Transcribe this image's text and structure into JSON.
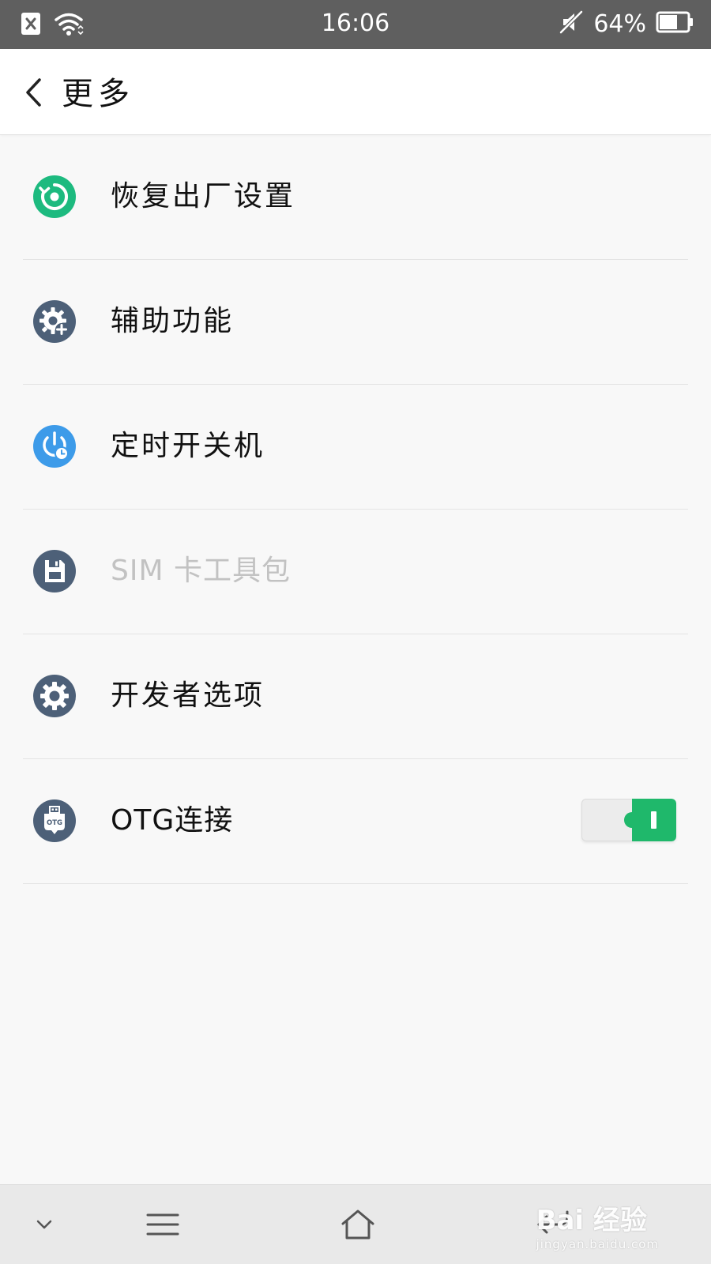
{
  "status_bar": {
    "time": "16:06",
    "battery_percent": "64%",
    "battery_level": 0.64,
    "icons": [
      "close-notification-icon",
      "wifi-icon",
      "mute-icon",
      "battery-icon"
    ]
  },
  "header": {
    "title": "更多",
    "back_icon": "chevron-left-icon"
  },
  "list": {
    "items": [
      {
        "label": "恢复出厂设置",
        "icon": "factory-reset-icon",
        "icon_color": "#1dba7f",
        "enabled": true
      },
      {
        "label": "辅助功能",
        "icon": "accessibility-gear-icon",
        "icon_color": "#4d6078",
        "enabled": true
      },
      {
        "label": "定时开关机",
        "icon": "scheduled-power-icon",
        "icon_color": "#3d9be9",
        "enabled": true
      },
      {
        "label": "SIM 卡工具包",
        "icon": "sim-toolkit-icon",
        "icon_color": "#4d6078",
        "enabled": false
      },
      {
        "label": "开发者选项",
        "icon": "developer-gear-icon",
        "icon_color": "#4d6078",
        "enabled": true
      },
      {
        "label": "OTG连接",
        "icon": "otg-icon",
        "icon_color": "#4d6078",
        "enabled": true,
        "toggle_on": true,
        "toggle_color": "#1fb86b"
      }
    ]
  },
  "nav_bar": {
    "icons": [
      "collapse-chevron-icon",
      "menu-icon",
      "home-icon",
      "back-icon"
    ]
  },
  "watermark": {
    "top": "Bai 经验",
    "bottom": "jingyan.baidu.com"
  }
}
